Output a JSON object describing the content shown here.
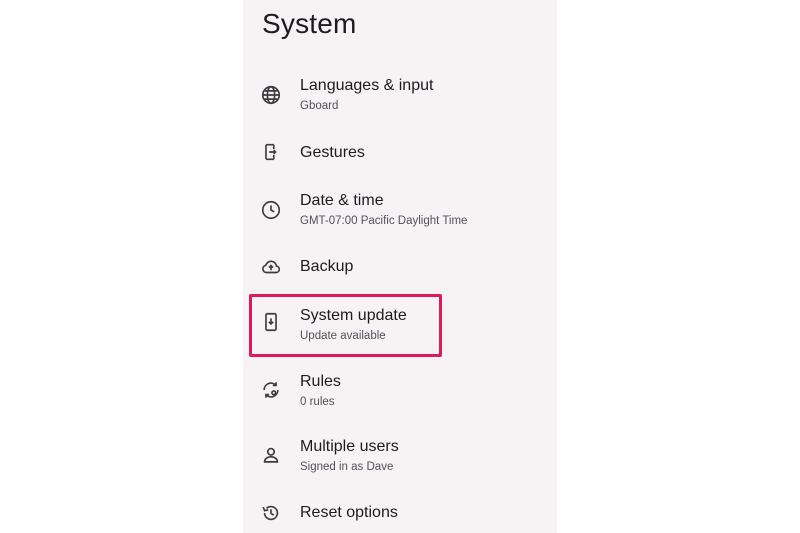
{
  "header": {
    "title": "System"
  },
  "items": [
    {
      "label": "Languages & input",
      "subtitle": "Gboard",
      "icon": "globe-icon"
    },
    {
      "label": "Gestures",
      "subtitle": "",
      "icon": "phone-gesture-icon"
    },
    {
      "label": "Date & time",
      "subtitle": "GMT-07:00 Pacific Daylight Time",
      "icon": "clock-icon"
    },
    {
      "label": "Backup",
      "subtitle": "",
      "icon": "cloud-upload-icon"
    },
    {
      "label": "System update",
      "subtitle": "Update available",
      "icon": "system-update-icon"
    },
    {
      "label": "Rules",
      "subtitle": "0 rules",
      "icon": "rules-icon"
    },
    {
      "label": "Multiple users",
      "subtitle": "Signed in as Dave",
      "icon": "person-icon"
    },
    {
      "label": "Reset options",
      "subtitle": "",
      "icon": "history-icon"
    }
  ],
  "colors": {
    "background": "#f7f2f4",
    "highlight": "#e0185c",
    "text": "#1c1b1f",
    "subtext": "#55505a"
  }
}
